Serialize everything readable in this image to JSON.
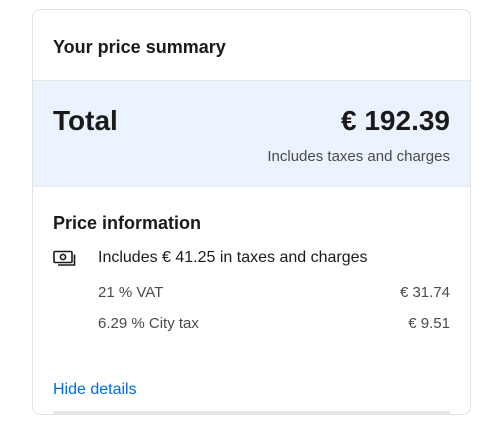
{
  "summary": {
    "title": "Your price summary",
    "total_label": "Total",
    "total_value": "€ 192.39",
    "total_note": "Includes taxes and charges"
  },
  "price_info": {
    "title": "Price information",
    "icon": "money-icon",
    "includes_text": "Includes € 41.25 in taxes and charges",
    "breakdown": [
      {
        "label": "21 % VAT",
        "value": "€ 31.74"
      },
      {
        "label": "6.29 % City tax",
        "value": "€ 9.51"
      }
    ],
    "hide_details_label": "Hide details"
  },
  "colors": {
    "total_background": "#ebf3ff",
    "link": "#006ce4"
  }
}
